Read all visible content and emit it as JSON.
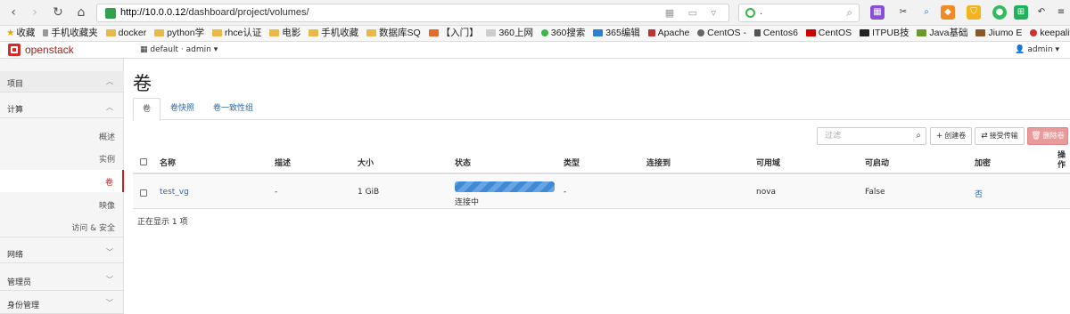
{
  "browser": {
    "url_host": "http://10.0.0.12",
    "url_path": "/dashboard/project/volumes/",
    "search_value": ".",
    "bookmarks": [
      "收藏",
      "手机收藏夹",
      "docker",
      "python学",
      "rhce认证",
      "电影",
      "手机收藏",
      "数据库SQ",
      "【入门】",
      "360上网",
      "360搜索",
      "365编辑",
      "Apache",
      "CentOS -",
      "Centos6",
      "CentOS",
      "ITPUB技",
      "Java基础",
      "Jiumo E",
      "keepaliv"
    ],
    "admin_user": "admin"
  },
  "header": {
    "logo": "openstack",
    "project_switch": "default · admin",
    "user": "admin"
  },
  "sidebar": {
    "panels": [
      {
        "label": "项目"
      },
      {
        "label": "计算"
      }
    ],
    "items": [
      {
        "label": "概述"
      },
      {
        "label": "实例"
      },
      {
        "label": "卷"
      },
      {
        "label": "映像"
      },
      {
        "label": "访问 & 安全"
      }
    ],
    "groups": [
      {
        "label": "网络"
      },
      {
        "label": "管理员"
      },
      {
        "label": "身份管理"
      }
    ]
  },
  "main": {
    "title": "卷",
    "tabs": [
      "卷",
      "卷快照",
      "卷一致性组"
    ],
    "filter_placeholder": "过滤",
    "buttons": {
      "create": "创建卷",
      "accept_transfer": "接受传输",
      "delete": "删除卷"
    },
    "columns": [
      "名称",
      "描述",
      "大小",
      "状态",
      "类型",
      "连接到",
      "可用域",
      "可启动",
      "加密",
      "操作"
    ],
    "rows": [
      {
        "name": "test_vg",
        "description": "-",
        "size": "1 GiB",
        "status": "连接中",
        "progress": 1.0,
        "type": "-",
        "attached_to": "",
        "zone": "nova",
        "bootable": "False",
        "encrypted": "否"
      }
    ],
    "footer": "正在显示 1 项"
  },
  "colors": {
    "brand_red": "#cc1e1e",
    "link_blue": "#2a6ab1",
    "progress_blue": "#3e8ad6",
    "danger_button": "#e99a9a"
  }
}
